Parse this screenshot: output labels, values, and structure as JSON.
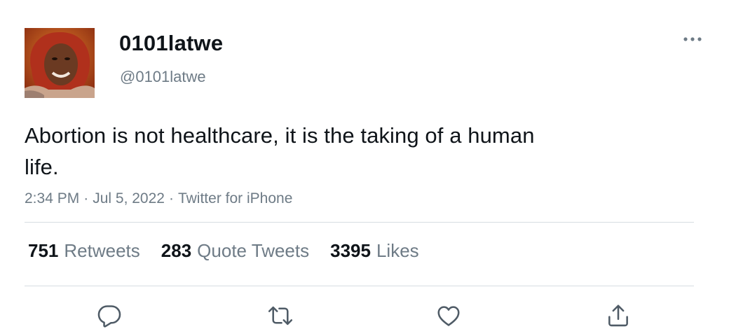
{
  "user": {
    "display_name": "0101latwe",
    "handle": "@0101latwe",
    "avatar_icon": "profile-photo"
  },
  "tweet": {
    "text": "Abortion is not healthcare, it is the taking of a human life.",
    "time": "2:34 PM",
    "date": "Jul 5, 2022",
    "source": "Twitter for iPhone",
    "separator": "·"
  },
  "stats": [
    {
      "count": "751",
      "label": "Retweets"
    },
    {
      "count": "283",
      "label": "Quote Tweets"
    },
    {
      "count": "3395",
      "label": "Likes"
    }
  ],
  "actions": [
    {
      "icon": "reply-icon"
    },
    {
      "icon": "retweet-icon"
    },
    {
      "icon": "like-icon"
    },
    {
      "icon": "share-icon"
    }
  ],
  "more_icon": "more-icon",
  "colors": {
    "text_primary": "#0f1419",
    "text_secondary": "#6e7b86",
    "divider": "#d6dde2",
    "icon": "#4f5b66"
  }
}
